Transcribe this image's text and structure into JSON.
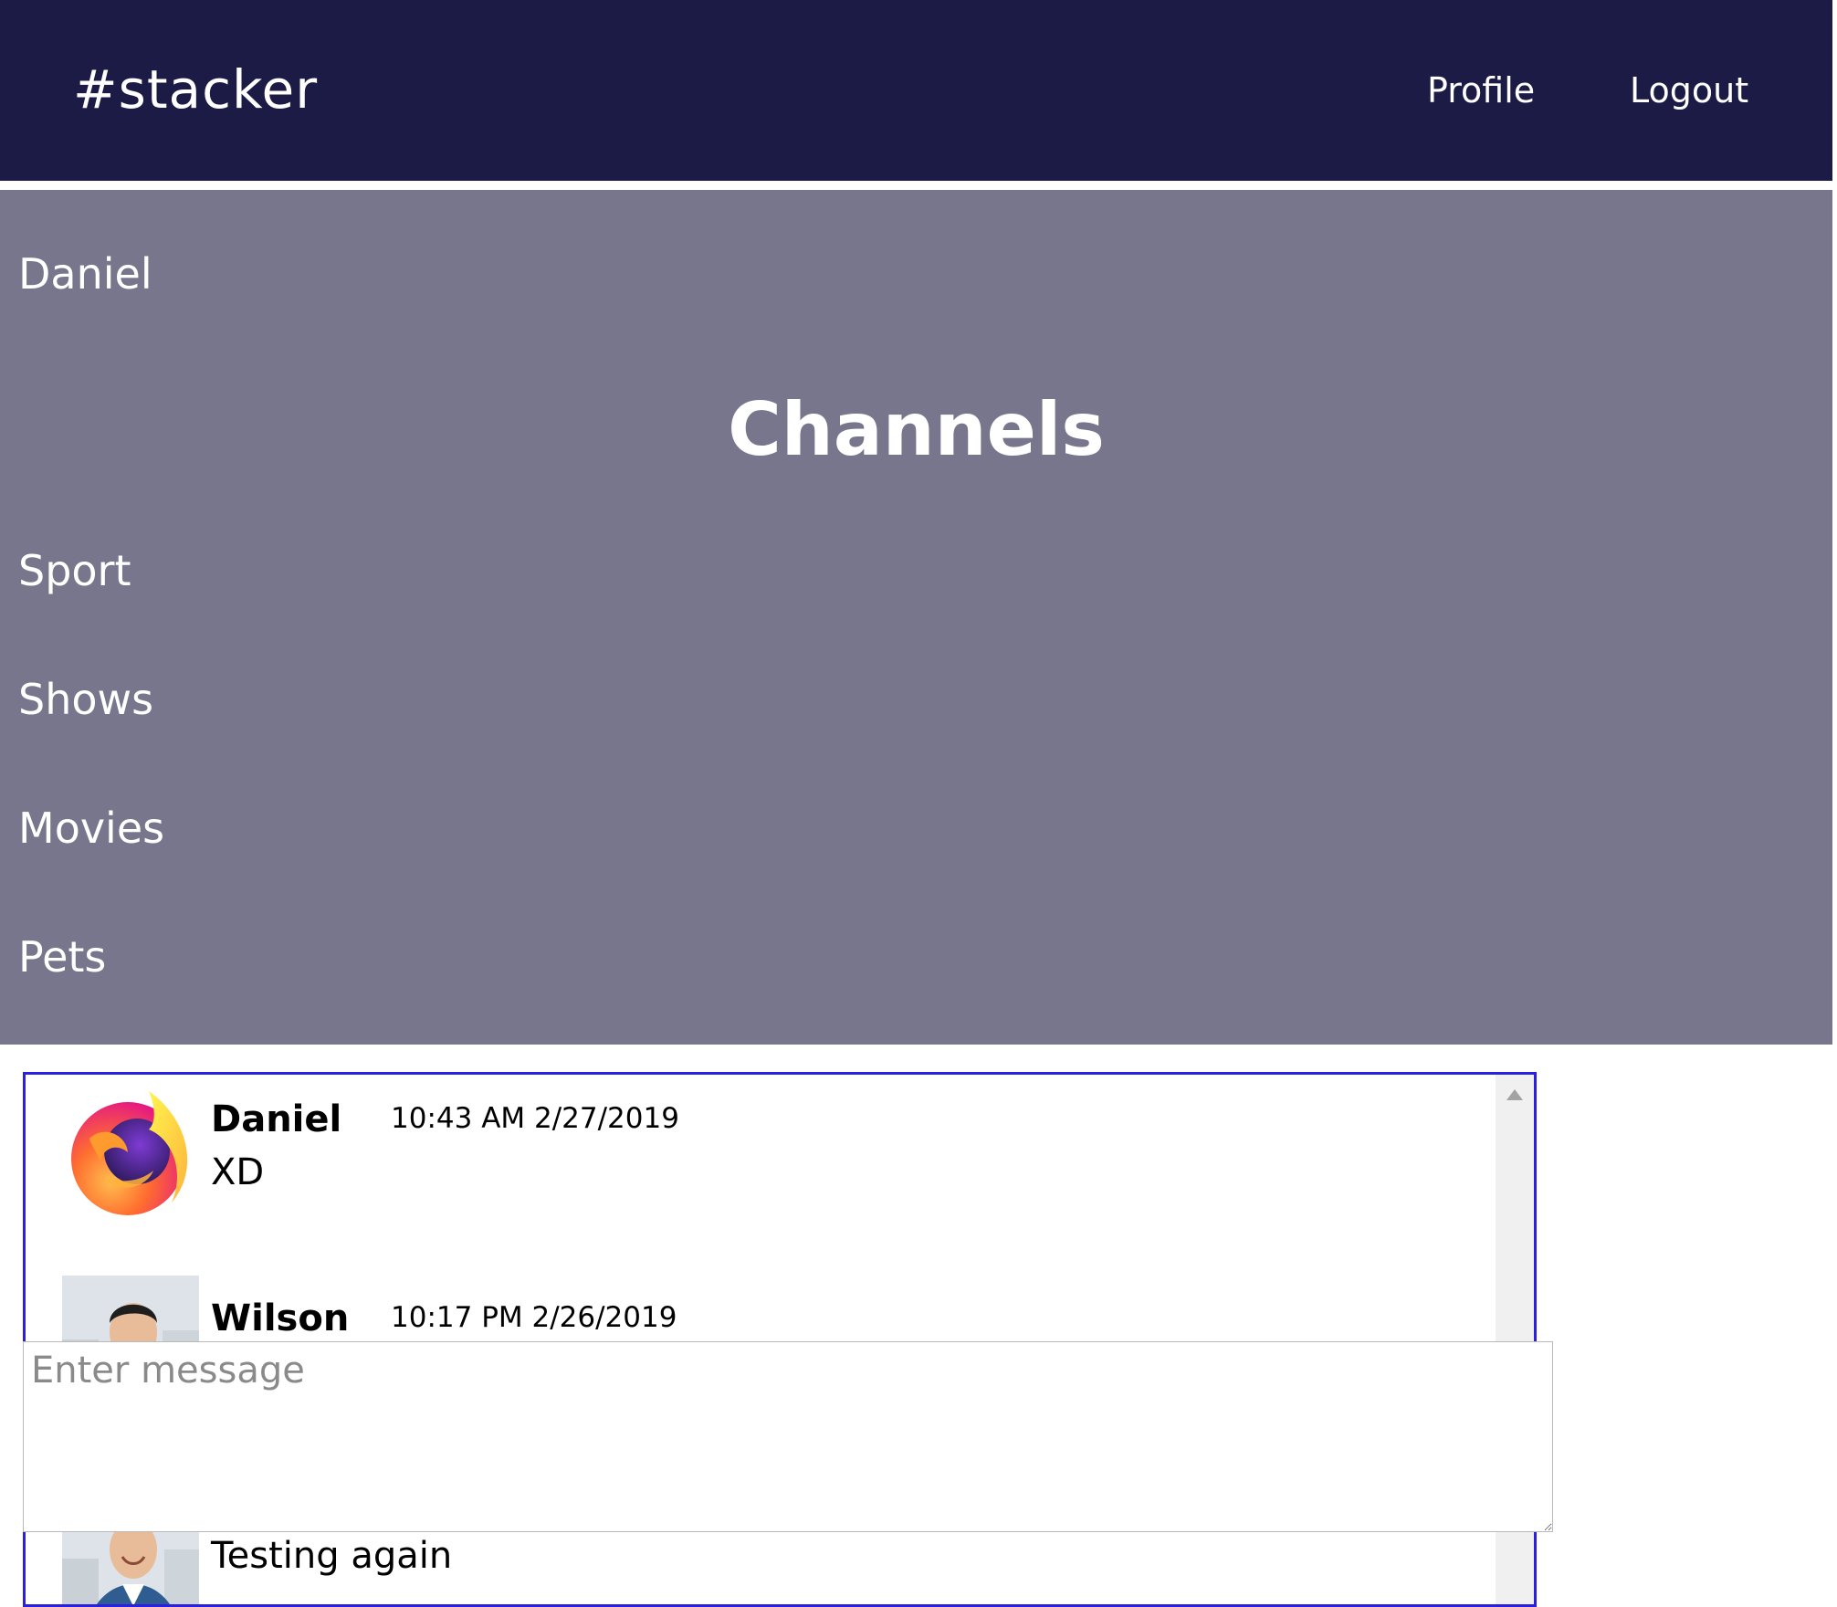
{
  "navbar": {
    "brand": "#stacker",
    "links": [
      "Profile",
      "Logout"
    ]
  },
  "sidebar": {
    "username": "Daniel",
    "heading": "Channels",
    "channels": [
      "Sport",
      "Shows",
      "Movies",
      "Pets"
    ]
  },
  "messages": [
    {
      "author": "Daniel",
      "time": "10:43 AM 2/27/2019",
      "text": "XD",
      "avatar": "firefox-logo-icon"
    },
    {
      "author": "Wilson",
      "time": "10:17 PM 2/26/2019",
      "text": "Testing again",
      "avatar": "user-photo"
    }
  ],
  "composer": {
    "placeholder": "Enter message",
    "value": ""
  },
  "colors": {
    "navbar": "#1c1b46",
    "panel": "#77768c",
    "message_border": "#2b1fe0"
  }
}
